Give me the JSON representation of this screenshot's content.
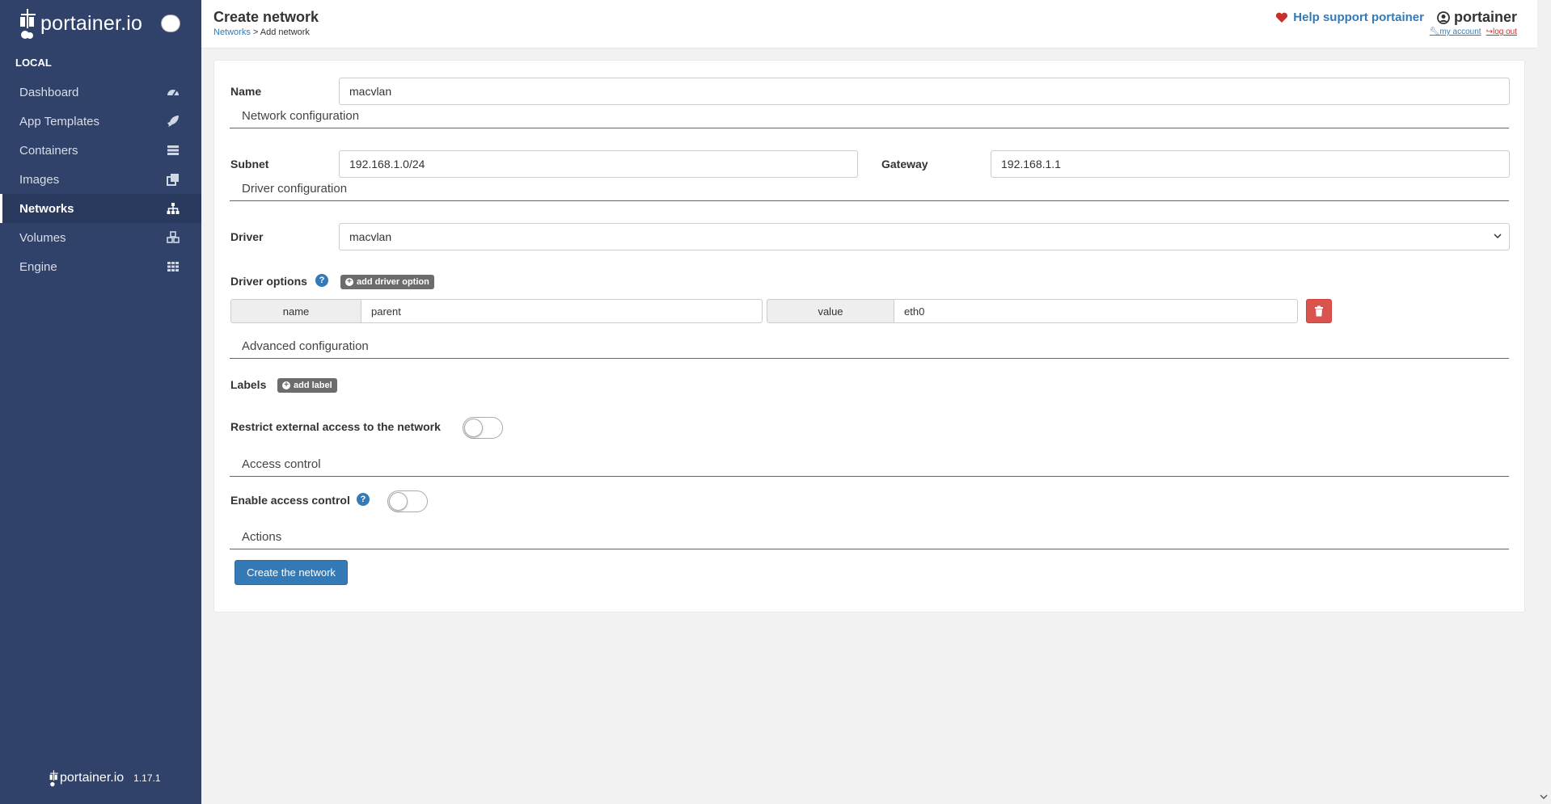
{
  "app": {
    "brand": "portainer.io",
    "version": "1.17.1"
  },
  "sidebar": {
    "section_title": "LOCAL",
    "items": [
      {
        "label": "Dashboard",
        "icon": "dashboard-icon",
        "active": false
      },
      {
        "label": "App Templates",
        "icon": "rocket-icon",
        "active": false
      },
      {
        "label": "Containers",
        "icon": "server-icon",
        "active": false
      },
      {
        "label": "Images",
        "icon": "clone-icon",
        "active": false
      },
      {
        "label": "Networks",
        "icon": "sitemap-icon",
        "active": true
      },
      {
        "label": "Volumes",
        "icon": "cubes-icon",
        "active": false
      },
      {
        "label": "Engine",
        "icon": "th-icon",
        "active": false
      }
    ]
  },
  "header": {
    "title": "Create network",
    "breadcrumb_link": "Networks",
    "breadcrumb_sep": " > ",
    "breadcrumb_current": "Add network",
    "help_text": "Help support portainer",
    "username": "portainer",
    "my_account": "my account",
    "log_out": "log out"
  },
  "form": {
    "name_label": "Name",
    "name_value": "macvlan",
    "section_network": "Network configuration",
    "subnet_label": "Subnet",
    "subnet_value": "192.168.1.0/24",
    "gateway_label": "Gateway",
    "gateway_value": "192.168.1.1",
    "section_driver": "Driver configuration",
    "driver_label": "Driver",
    "driver_value": "macvlan",
    "driver_options_label": "Driver options",
    "add_driver_option": "add driver option",
    "option_name_addon": "name",
    "option_name_value": "parent",
    "option_value_addon": "value",
    "option_value_value": "eth0",
    "section_advanced": "Advanced configuration",
    "labels_label": "Labels",
    "add_label": "add label",
    "restrict_label": "Restrict external access to the network",
    "restrict_enabled": false,
    "section_access": "Access control",
    "access_label": "Enable access control",
    "access_enabled": false,
    "section_actions": "Actions",
    "create_button": "Create the network"
  },
  "colors": {
    "sidebar_bg": "#30426a",
    "primary": "#337ab7",
    "danger": "#d9534f",
    "heart": "#c9302c"
  }
}
